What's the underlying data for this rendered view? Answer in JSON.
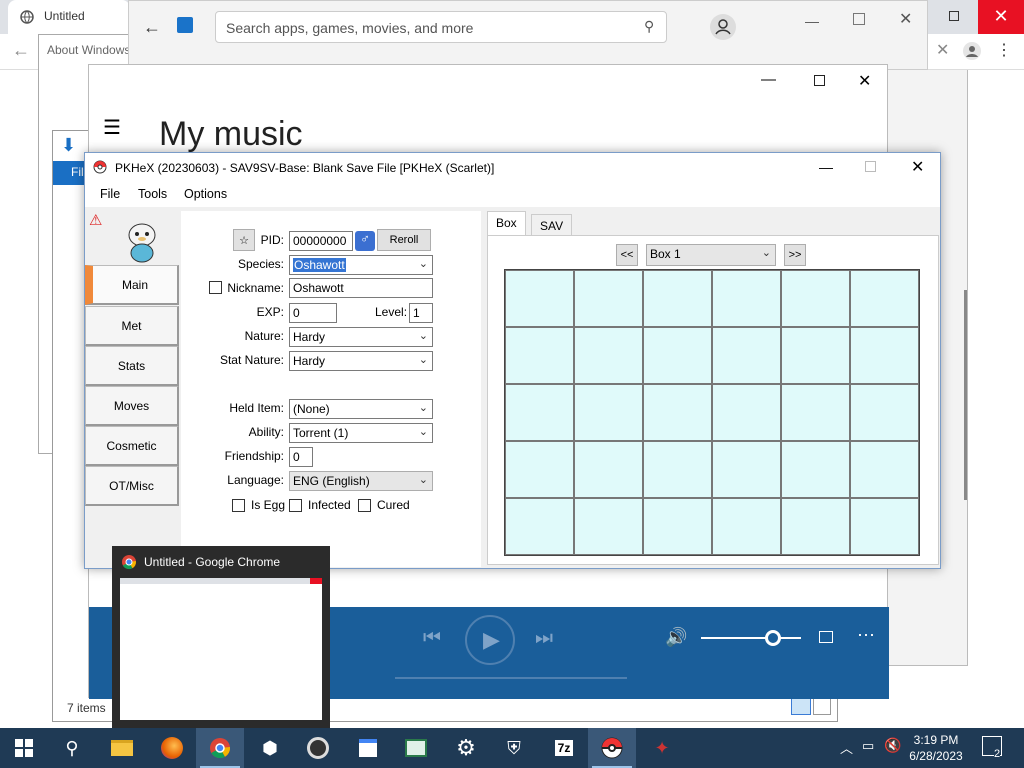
{
  "chrome": {
    "tab_title": "Untitled",
    "colors": {
      "tabbar": "#dee1e6"
    }
  },
  "about": {
    "title": "About Windows"
  },
  "store": {
    "search_placeholder": "Search apps, games, movies, and more"
  },
  "groove": {
    "title": "My music"
  },
  "explorer": {
    "ribbon_label": "Fil",
    "status": "7 items"
  },
  "pkhex": {
    "title": "PKHeX (20230603) - SAV9SV-Base: Blank Save File [PKHeX (Scarlet)]",
    "menu": [
      "File",
      "Tools",
      "Options"
    ],
    "side_tabs": [
      "Main",
      "Met",
      "Stats",
      "Moves",
      "Cosmetic",
      "OT/Misc"
    ],
    "main": {
      "pid_label": "PID:",
      "pid_value": "00000000",
      "reroll_label": "Reroll",
      "species_label": "Species:",
      "species_value": "Oshawott",
      "nickname_label": "Nickname:",
      "nickname_value": "Oshawott",
      "exp_label": "EXP:",
      "exp_value": "0",
      "level_label": "Level:",
      "level_value": "1",
      "nature_label": "Nature:",
      "nature_value": "Hardy",
      "stat_nature_label": "Stat Nature:",
      "stat_nature_value": "Hardy",
      "held_item_label": "Held Item:",
      "held_item_value": "(None)",
      "ability_label": "Ability:",
      "ability_value": "Torrent (1)",
      "friendship_label": "Friendship:",
      "friendship_value": "0",
      "language_label": "Language:",
      "language_value": "ENG (English)",
      "is_egg_label": "Is Egg",
      "infected_label": "Infected",
      "cured_label": "Cured"
    },
    "box": {
      "tabs": [
        "Box",
        "SAV"
      ],
      "prev_label": "<<",
      "next_label": ">>",
      "box_name": "Box 1"
    }
  },
  "preview": {
    "title": "Untitled - Google Chrome"
  },
  "taskbar": {
    "time": "3:19 PM",
    "date": "6/28/2023",
    "notification_count": "2",
    "colors": {
      "background": "#1f3a55"
    }
  }
}
